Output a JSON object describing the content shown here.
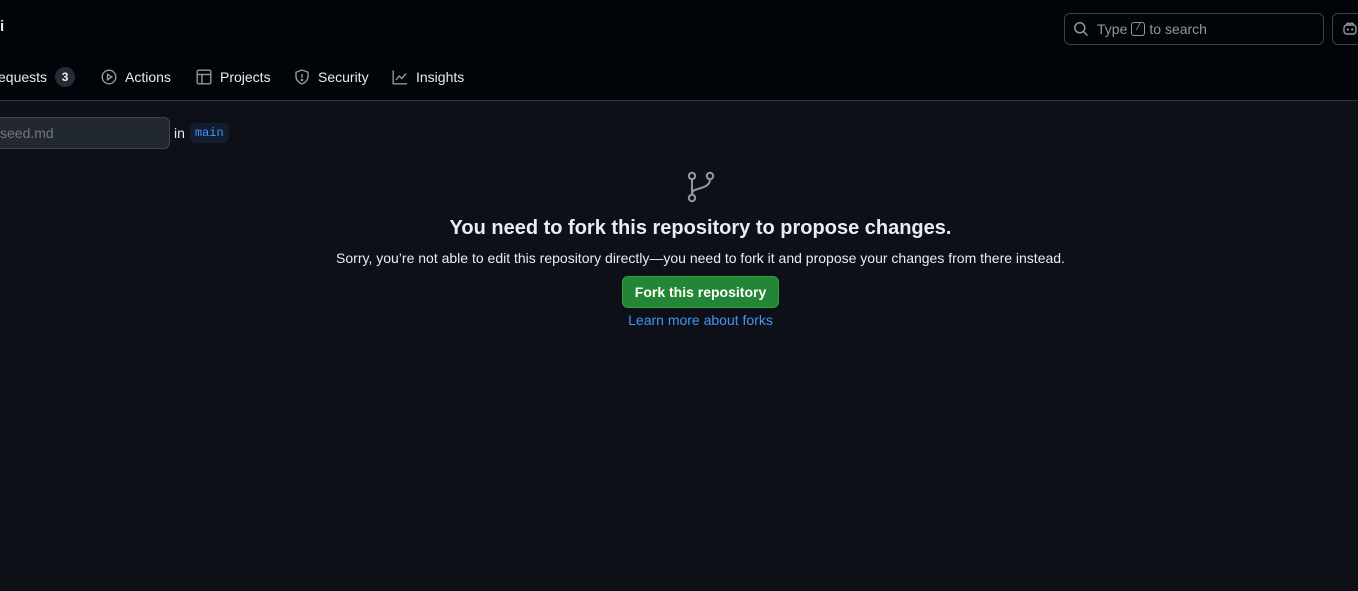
{
  "header": {
    "repo_title": "i",
    "search": {
      "prefix": "Type",
      "key": "/",
      "suffix": "to search"
    }
  },
  "tabs": {
    "pull_requests": {
      "label": "equests",
      "count": "3"
    },
    "actions": {
      "label": "Actions"
    },
    "projects": {
      "label": "Projects"
    },
    "security": {
      "label": "Security"
    },
    "insights": {
      "label": "Insights"
    }
  },
  "editor": {
    "filename_placeholder": "seed.md",
    "in_label": "in",
    "branch": "main"
  },
  "blankslate": {
    "icon": "git-branch-icon",
    "title": "You need to fork this repository to propose changes.",
    "description": "Sorry, you’re not able to edit this repository directly—you need to fork it and propose your changes from there instead.",
    "fork_button": "Fork this repository",
    "learn_link": "Learn more about forks"
  },
  "colors": {
    "background": "#0d1117",
    "header": "#010409",
    "primary_button": "#238636",
    "link": "#4493f8"
  }
}
